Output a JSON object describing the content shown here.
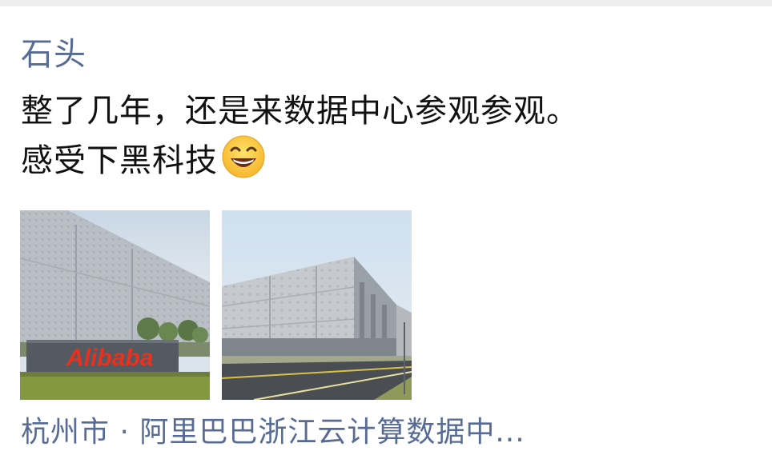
{
  "post": {
    "author": "石头",
    "text_line_1": "整了几年，还是来数据中心参观参观。",
    "text_line_2": "感受下黑科技",
    "emoji": "grinning-face-emoji",
    "photos": [
      {
        "icon": "alibaba-datacenter-photo",
        "sign_text": "Alibaba"
      },
      {
        "icon": "datacenter-building-photo"
      }
    ],
    "location": "杭州市 · 阿里巴巴浙江云计算数据中..."
  },
  "colors": {
    "name_link": "#576b95",
    "body_text": "#111111",
    "brand_sign": "#e8311f"
  }
}
